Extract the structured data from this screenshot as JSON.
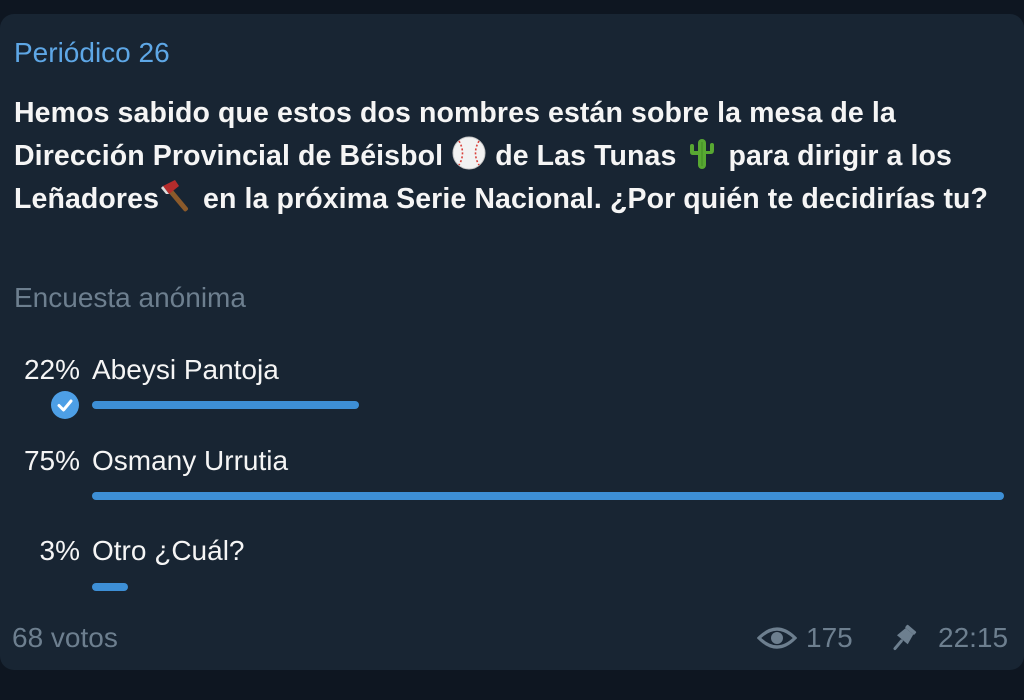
{
  "message": {
    "channel_name": "Periódico 26",
    "question": {
      "part1": "Hemos sabido que estos  dos nombres están sobre la mesa de la Dirección Provincial de Béisbol ",
      "emoji1": "baseball-emoji",
      "part2": " de Las Tunas ",
      "emoji2": "cactus-emoji",
      "part3": " para dirigir a los Leñadores",
      "emoji3": "axe-emoji",
      "part4": " en la próxima Serie Nacional. ¿Por quién te decidirías tu?"
    },
    "poll_type": "Encuesta anónima",
    "options": [
      {
        "percent_label": "22%",
        "label": "Abeysi Pantoja",
        "percent": 22,
        "voted": true
      },
      {
        "percent_label": "75%",
        "label": "Osmany Urrutia",
        "percent": 75,
        "voted": false
      },
      {
        "percent_label": "3%",
        "label": "Otro ¿Cuál?",
        "percent": 3,
        "voted": false
      }
    ],
    "votes_label": "68 votos",
    "views": "175",
    "time": "22:15",
    "icons": {
      "views": "eye-icon",
      "pinned": "pin-icon",
      "voted": "check-circle-icon"
    }
  },
  "colors": {
    "background": "#0e1621",
    "bubble": "#182533",
    "accent": "#3d8fd6",
    "channel_name": "#5ea7e6",
    "text": "#f5f5f5",
    "muted": "#6d7f8f"
  }
}
